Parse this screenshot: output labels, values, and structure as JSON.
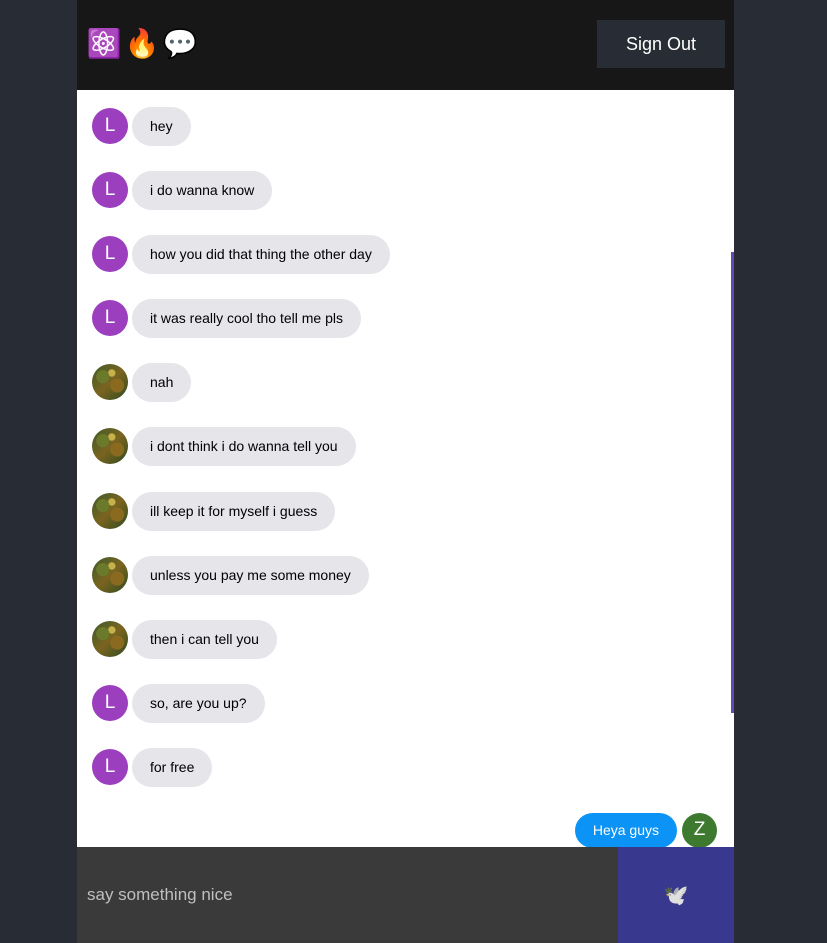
{
  "header": {
    "icons": [
      "atom-icon",
      "fire-icon",
      "speech-bubble-icon"
    ],
    "icon_glyphs": [
      "⚛️",
      "🔥",
      "💬"
    ],
    "signout_label": "Sign Out"
  },
  "messages": [
    {
      "avatar_type": "letter",
      "avatar_letter": "L",
      "text": "hey"
    },
    {
      "avatar_type": "letter",
      "avatar_letter": "L",
      "text": "i do wanna know"
    },
    {
      "avatar_type": "letter",
      "avatar_letter": "L",
      "text": "how you did that thing the other day"
    },
    {
      "avatar_type": "letter",
      "avatar_letter": "L",
      "text": "it was really cool tho tell me pls"
    },
    {
      "avatar_type": "image",
      "avatar_letter": "",
      "text": "nah"
    },
    {
      "avatar_type": "image",
      "avatar_letter": "",
      "text": "i dont think i do wanna tell you"
    },
    {
      "avatar_type": "image",
      "avatar_letter": "",
      "text": "ill keep it for myself i guess"
    },
    {
      "avatar_type": "image",
      "avatar_letter": "",
      "text": "unless you pay me some money"
    },
    {
      "avatar_type": "image",
      "avatar_letter": "",
      "text": "then i can tell you"
    },
    {
      "avatar_type": "letter",
      "avatar_letter": "L",
      "text": "so, are you up?"
    },
    {
      "avatar_type": "letter",
      "avatar_letter": "L",
      "text": "for free"
    }
  ],
  "sent_message": {
    "text": "Heya guys",
    "avatar_letter": "Z"
  },
  "form": {
    "placeholder": "say something nice",
    "send_icon": "🕊️"
  },
  "colors": {
    "header_bg": "#181717",
    "received_bubble": "#e5e5ea",
    "sent_bubble": "#0b93f6",
    "send_button": "#38388f",
    "input_bg": "#3a3a3a"
  }
}
